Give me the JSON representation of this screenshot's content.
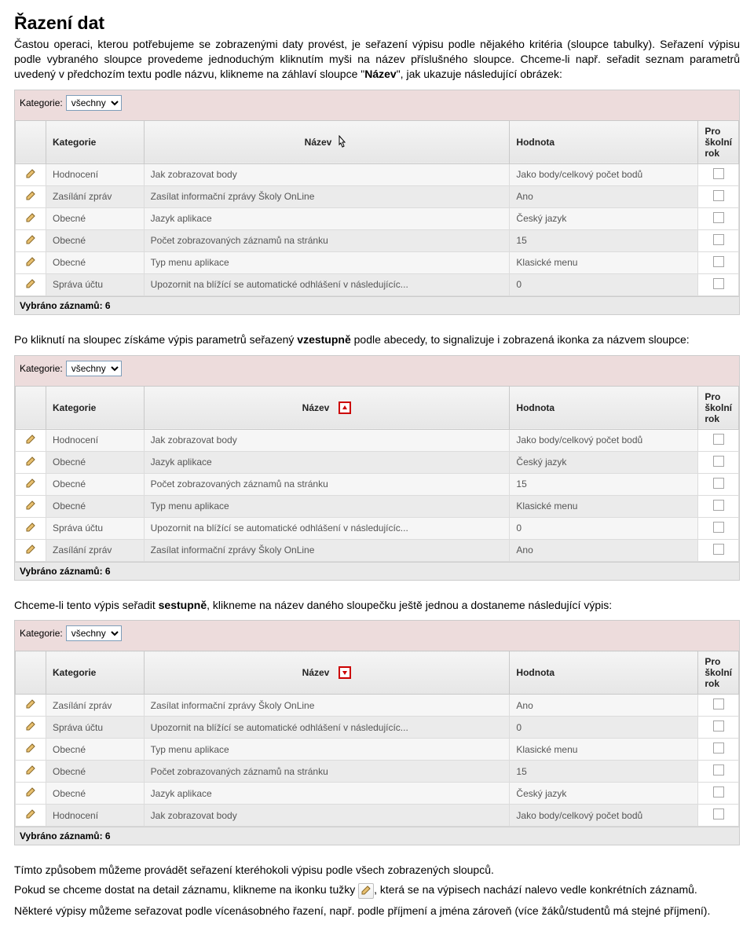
{
  "title": "Řazení dat",
  "intro": "Častou operaci, kterou potřebujeme se zobrazenými daty provést, je seřazení výpisu podle nějakého kritéria (sloupce tabulky). Seřazení výpisu podle vybraného sloupce provedeme jednoduchým kliknutím myši na název příslušného sloupce. Chceme-li např. seřadit seznam parametrů uvedený v předchozím textu podle názvu, klikneme na záhlaví sloupce \"",
  "intro_bold": "Název",
  "intro_after": "\", jak ukazuje následující obrázek:",
  "para2_a": "Po kliknutí na sloupec získáme výpis parametrů seřazený ",
  "para2_b": "vzestupně",
  "para2_c": " podle abecedy, to signalizuje i zobrazená ikonka za názvem sloupce:",
  "para3_a": "Chceme-li tento výpis seřadit ",
  "para3_b": "sestupně",
  "para3_c": ", klikneme na název daného sloupečku ještě jednou a dostaneme následující výpis:",
  "para4": "Tímto způsobem můžeme provádět seřazení kteréhokoli výpisu podle všech zobrazených sloupců.",
  "para5_a": "Pokud se chceme dostat na detail záznamu, klikneme na ikonku tužky ",
  "para5_b": ", která se na výpisech nachází nalevo vedle konkrétních záznamů.",
  "para6": "Některé výpisy můžeme seřazovat podle vícenásobného řazení, např. podle příjmení a jména zároveň (více žáků/studentů má stejné příjmení).",
  "filter_label": "Kategorie:",
  "filter_value": "všechny",
  "columns": {
    "col1": "Kategorie",
    "col2": "Název",
    "col3": "Hodnota",
    "col4": "Pro školní rok"
  },
  "footer_label": "Vybráno záznamů: 6",
  "table1": [
    {
      "cat": "Hodnocení",
      "name": "Jak zobrazovat body",
      "val": "Jako body/celkový počet bodů"
    },
    {
      "cat": "Zasílání zpráv",
      "name": "Zasílat informační zprávy Školy OnLine",
      "val": "Ano"
    },
    {
      "cat": "Obecné",
      "name": "Jazyk aplikace",
      "val": "Český jazyk"
    },
    {
      "cat": "Obecné",
      "name": "Počet zobrazovaných záznamů na stránku",
      "val": "15"
    },
    {
      "cat": "Obecné",
      "name": "Typ menu aplikace",
      "val": "Klasické menu"
    },
    {
      "cat": "Správa účtu",
      "name": "Upozornit na blížící se automatické odhlášení v následujícíc...",
      "val": "0"
    }
  ],
  "table2": [
    {
      "cat": "Hodnocení",
      "name": "Jak zobrazovat body",
      "val": "Jako body/celkový počet bodů"
    },
    {
      "cat": "Obecné",
      "name": "Jazyk aplikace",
      "val": "Český jazyk"
    },
    {
      "cat": "Obecné",
      "name": "Počet zobrazovaných záznamů na stránku",
      "val": "15"
    },
    {
      "cat": "Obecné",
      "name": "Typ menu aplikace",
      "val": "Klasické menu"
    },
    {
      "cat": "Správa účtu",
      "name": "Upozornit na blížící se automatické odhlášení v následujícíc...",
      "val": "0"
    },
    {
      "cat": "Zasílání zpráv",
      "name": "Zasílat informační zprávy Školy OnLine",
      "val": "Ano"
    }
  ],
  "table3": [
    {
      "cat": "Zasílání zpráv",
      "name": "Zasílat informační zprávy Školy OnLine",
      "val": "Ano"
    },
    {
      "cat": "Správa účtu",
      "name": "Upozornit na blížící se automatické odhlášení v následujícíc...",
      "val": "0"
    },
    {
      "cat": "Obecné",
      "name": "Typ menu aplikace",
      "val": "Klasické menu"
    },
    {
      "cat": "Obecné",
      "name": "Počet zobrazovaných záznamů na stránku",
      "val": "15"
    },
    {
      "cat": "Obecné",
      "name": "Jazyk aplikace",
      "val": "Český jazyk"
    },
    {
      "cat": "Hodnocení",
      "name": "Jak zobrazovat body",
      "val": "Jako body/celkový počet bodů"
    }
  ]
}
